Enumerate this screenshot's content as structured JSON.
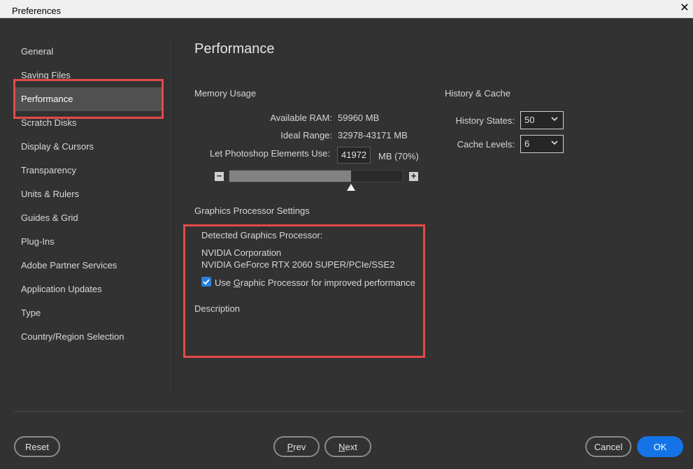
{
  "window": {
    "title": "Preferences",
    "close_glyph": "✕"
  },
  "sidebar": {
    "items": [
      {
        "label": "General",
        "active": false
      },
      {
        "label": "Saving Files",
        "active": false
      },
      {
        "label": "Performance",
        "active": true
      },
      {
        "label": "Scratch Disks",
        "active": false
      },
      {
        "label": "Display & Cursors",
        "active": false
      },
      {
        "label": "Transparency",
        "active": false
      },
      {
        "label": "Units & Rulers",
        "active": false
      },
      {
        "label": "Guides & Grid",
        "active": false
      },
      {
        "label": "Plug-Ins",
        "active": false
      },
      {
        "label": "Adobe Partner Services",
        "active": false
      },
      {
        "label": "Application Updates",
        "active": false
      },
      {
        "label": "Type",
        "active": false
      },
      {
        "label": "Country/Region Selection",
        "active": false
      }
    ]
  },
  "main": {
    "title": "Performance",
    "memory": {
      "heading": "Memory Usage",
      "available_label": "Available RAM:",
      "available_value": "59960 MB",
      "ideal_label": "Ideal Range:",
      "ideal_value": "32978-43171 MB",
      "use_label": "Let Photoshop Elements Use:",
      "use_value": "41972",
      "use_suffix": "MB (70%)",
      "slider_percent": 70,
      "minus_glyph": "−",
      "plus_glyph": "+"
    },
    "history_cache": {
      "heading": "History & Cache",
      "history_states_label": "History States:",
      "history_states_value": "50",
      "cache_levels_label": "Cache Levels:",
      "cache_levels_value": "6"
    },
    "gpu": {
      "heading": "Graphics Processor Settings",
      "detected_label": "Detected Graphics Processor:",
      "vendor": "NVIDIA Corporation",
      "model": "NVIDIA GeForce RTX 2060 SUPER/PCIe/SSE2",
      "use_gpu_prefix": "Use ",
      "use_gpu_accel": "G",
      "use_gpu_rest": "raphic Processor for improved performance",
      "use_gpu_checked": true,
      "description_label": "Description"
    }
  },
  "footer": {
    "reset_label": "Reset",
    "prev_accel": "P",
    "prev_rest": "rev",
    "next_accel": "N",
    "next_rest": "ext",
    "cancel_label": "Cancel",
    "ok_label": "OK"
  },
  "colors": {
    "highlight": "#e34a4a",
    "primary": "#1473e6",
    "background": "#323232"
  }
}
